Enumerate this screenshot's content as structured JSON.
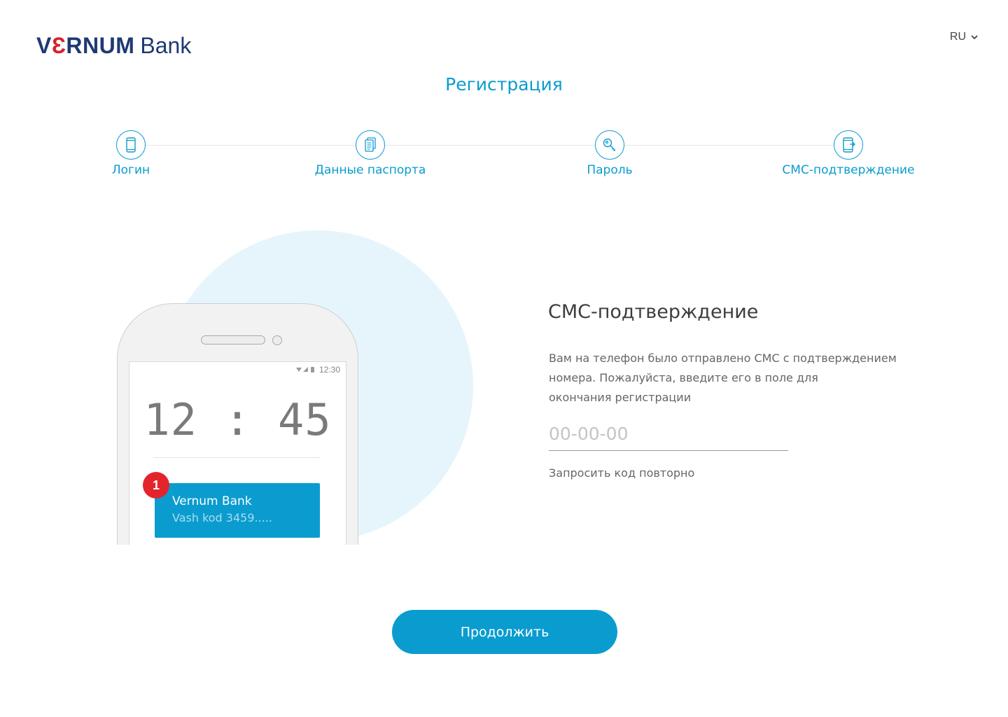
{
  "header": {
    "logo_brand_v": "V",
    "logo_brand_e": "Ɛ",
    "logo_brand_rest": "RNUM",
    "logo_bank": "Bank",
    "language": "RU"
  },
  "page": {
    "title": "Регистрация"
  },
  "steps": [
    {
      "label": "Логин",
      "icon": "phone-icon"
    },
    {
      "label": "Данные паспорта",
      "icon": "document-icon"
    },
    {
      "label": "Пароль",
      "icon": "key-icon"
    },
    {
      "label": "СМС-подтверждение",
      "icon": "sms-phone-icon"
    }
  ],
  "illustration": {
    "status_time": "12:30",
    "clock": "12 : 45",
    "badge": "1",
    "notification_title": "Vernum Bank",
    "notification_text": "Vash kod 3459....."
  },
  "form": {
    "title": "СМС-подтверждение",
    "description_lines": [
      "Вам на телефон было отправлено СМС с подтверждением",
      "номера. Пожалуйста, введите его в поле для",
      "окончания регистрации"
    ],
    "code_value": "",
    "code_placeholder": "00-00-00",
    "resend_link": "Запросить код повторно"
  },
  "actions": {
    "continue": "Продолжить"
  },
  "colors": {
    "accent": "#0a9ccf",
    "brand_navy": "#1e3a73",
    "brand_red": "#d6222a",
    "badge_red": "#e3252b"
  }
}
